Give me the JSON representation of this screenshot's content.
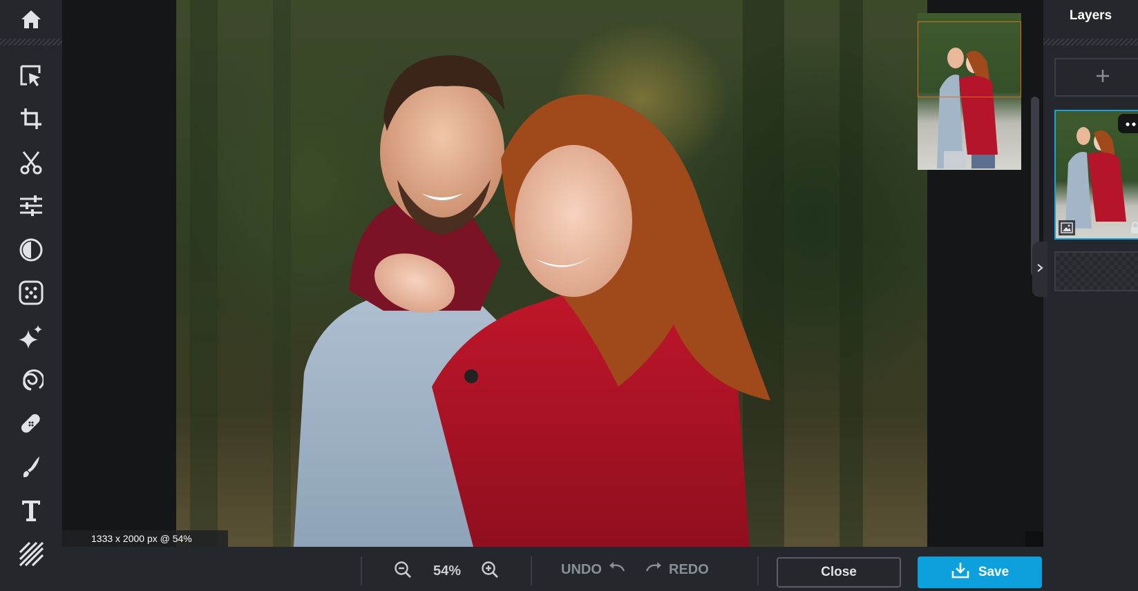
{
  "sidebar": {
    "tools": [
      {
        "name": "home-icon"
      },
      {
        "name": "select-arrange-icon"
      },
      {
        "name": "crop-icon"
      },
      {
        "name": "cutout-scissors-icon"
      },
      {
        "name": "adjust-sliders-icon"
      },
      {
        "name": "filter-contrast-icon"
      },
      {
        "name": "effects-dots-icon"
      },
      {
        "name": "retouch-sparkle-icon"
      },
      {
        "name": "liquify-swirl-icon"
      },
      {
        "name": "heal-bandage-icon"
      },
      {
        "name": "draw-brush-icon"
      },
      {
        "name": "text-icon"
      },
      {
        "name": "pattern-stripes-icon"
      }
    ]
  },
  "canvas": {
    "info": "1333 x 2000 px @ 54%"
  },
  "layers": {
    "title": "Layers",
    "add_label": "+"
  },
  "bottom_bar": {
    "zoom_value": "54%",
    "undo_label": "UNDO",
    "redo_label": "REDO",
    "close_label": "Close",
    "save_label": "Save"
  },
  "colors": {
    "accent": "#0ca0dc",
    "navigator_frame": "#e46a1c",
    "panel_bg": "#24272b",
    "canvas_bg": "#151618"
  }
}
